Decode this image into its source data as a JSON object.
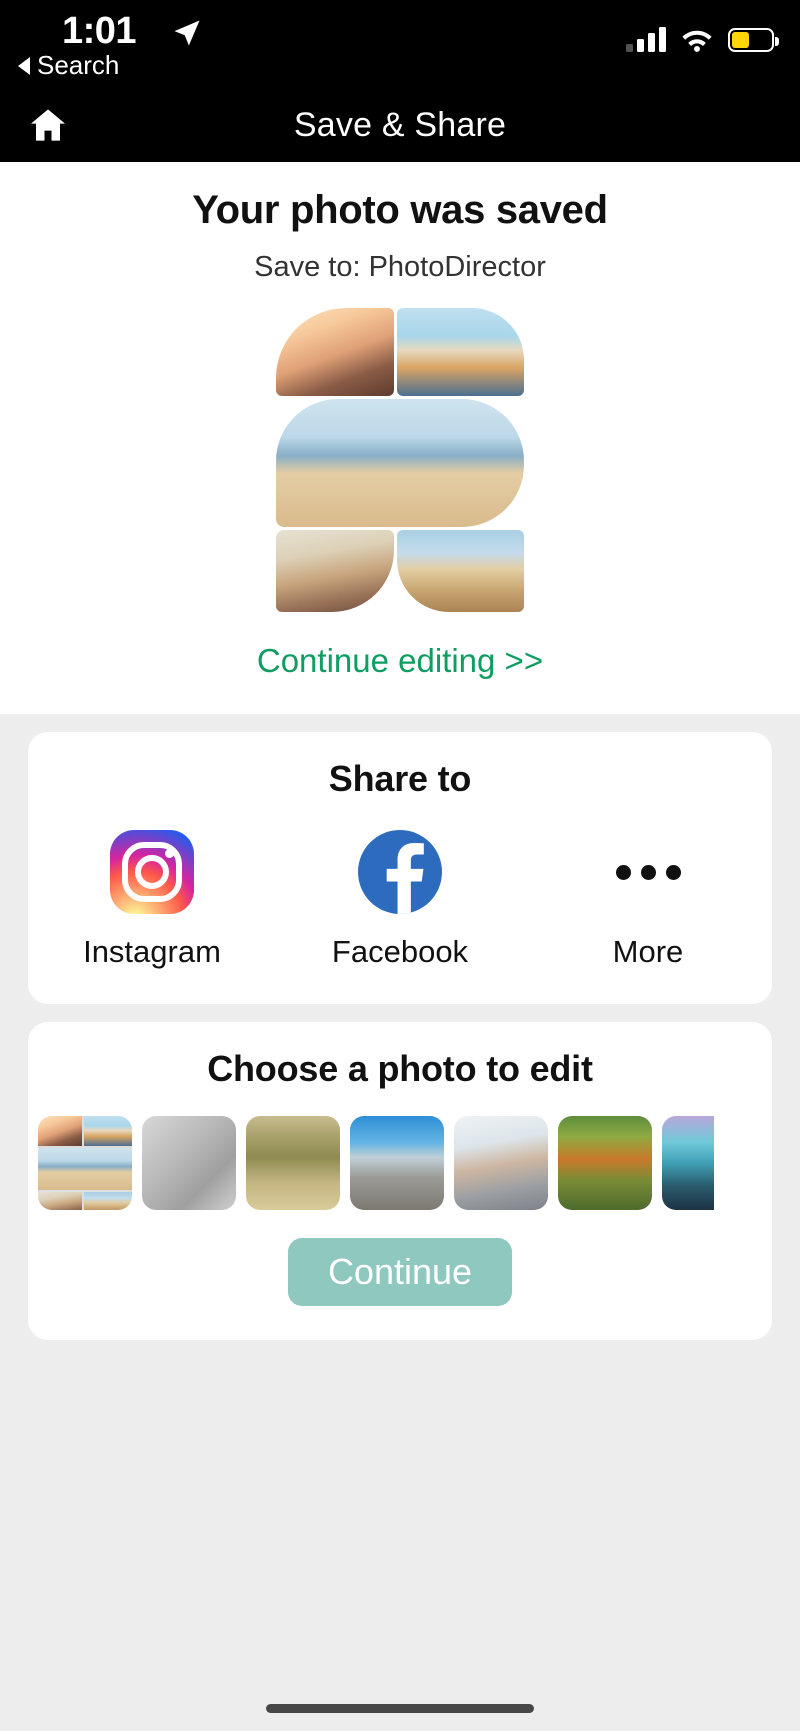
{
  "status_bar": {
    "time": "1:01",
    "location_icon": "location-arrow-icon",
    "back_label": "Search",
    "signal_icon": "cellular-signal-icon",
    "wifi_icon": "wifi-icon",
    "battery_icon": "battery-low-power-icon",
    "battery_level_percent": 45,
    "battery_color": "#FFD60A"
  },
  "nav": {
    "home_icon": "home-icon",
    "title": "Save & Share"
  },
  "saved": {
    "heading": "Your photo was saved",
    "subtitle": "Save to: PhotoDirector",
    "continue_editing_label": "Continue editing >>",
    "link_color": "#0f9d62",
    "collage_cells": [
      {
        "name": "collage-cell-selfie",
        "alt": "three women taking a selfie on the beach"
      },
      {
        "name": "collage-cell-dog",
        "alt": "woman sitting on sand with golden retriever"
      },
      {
        "name": "collage-cell-group",
        "alt": "group of friends jumping on the beach"
      },
      {
        "name": "collage-cell-hat",
        "alt": "woman in straw hat smiling"
      },
      {
        "name": "collage-cell-backs",
        "alt": "friends walking away on the beach"
      }
    ]
  },
  "share": {
    "heading": "Share to",
    "items": [
      {
        "label": "Instagram",
        "icon": "instagram-icon"
      },
      {
        "label": "Facebook",
        "icon": "facebook-icon"
      },
      {
        "label": "More",
        "icon": "more-ellipsis-icon"
      }
    ],
    "facebook_color": "#2D6BBF"
  },
  "chooser": {
    "heading": "Choose a photo to edit",
    "thumbnails": [
      {
        "name": "thumbnail-collage",
        "alt": "beach friends collage"
      },
      {
        "name": "thumbnail-gray",
        "alt": "plain gray gradient image"
      },
      {
        "name": "thumbnail-bicycle",
        "alt": "person riding bicycle in dry field"
      },
      {
        "name": "thumbnail-city",
        "alt": "city rooftops under blue sky"
      },
      {
        "name": "thumbnail-couple",
        "alt": "smiling couple piggyback"
      },
      {
        "name": "thumbnail-autumn",
        "alt": "autumn trees along a road"
      },
      {
        "name": "thumbnail-quote",
        "alt": "teal landscape with script text"
      }
    ],
    "continue_label": "Continue",
    "continue_button_color": "#8FC8BE"
  }
}
